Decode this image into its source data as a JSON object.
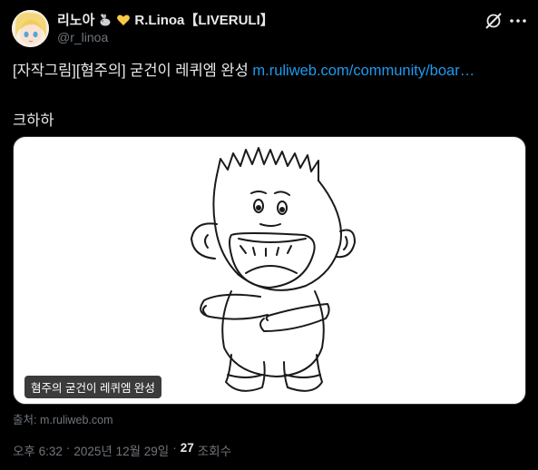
{
  "author": {
    "display_name_prefix": "리노아",
    "display_name_suffix": "R.Linoa【LIVERULI】",
    "handle": "@r_linoa",
    "emoji_1": "rabbit-icon",
    "emoji_2": "yellow-heart-icon"
  },
  "tweet": {
    "text_main": "[자작그림][혐주의] 굳건이 레퀴엠 완성 ",
    "link_text": "m.ruliweb.com/community/boar…",
    "text_second": "크하하"
  },
  "media": {
    "label": "혐주의 굳건이 레퀴엠 완성",
    "source": "출처: m.ruliweb.com"
  },
  "meta": {
    "time": "오후 6:32",
    "sep1": "·",
    "date": "2025년 12월 29일",
    "sep2": "·",
    "view_count": "27",
    "view_label": "조회수"
  },
  "colors": {
    "background": "#000000",
    "text": "#e7e9ea",
    "muted": "#71767b",
    "link": "#1d9bf0"
  }
}
